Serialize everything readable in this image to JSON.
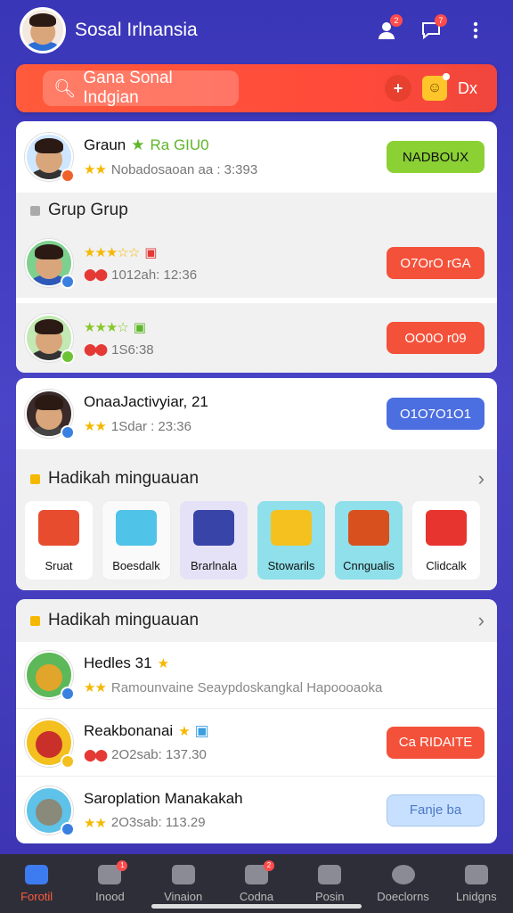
{
  "header": {
    "title": "Sosal Irlnansia",
    "friends_badge": "2",
    "chat_badge": "7"
  },
  "search": {
    "placeholder": "Gana Sonal Indgian",
    "right_label": "Dx"
  },
  "card1": {
    "row1": {
      "name": "Graun",
      "name_tag": "Ra GIU0",
      "meta": "Nobadosaoan aa : 3:393",
      "button": "NADBOUX"
    },
    "section_title": "Grup Grup",
    "row2": {
      "meta": "1012ah: 12:36",
      "button": "O7OrO rGA"
    },
    "row3": {
      "meta": "1S6:38",
      "button": "OO0O r09"
    }
  },
  "card2": {
    "row1": {
      "name": "OnaaJactivyiar, 21",
      "meta": "1Sdar : 23:36",
      "button": "O1O7O1O1"
    },
    "section_title": "Hadikah minguauan",
    "gifts": [
      {
        "label": "Sruat"
      },
      {
        "label": "Boesdalk"
      },
      {
        "label": "Brarlnala"
      },
      {
        "label": "Stowarils"
      },
      {
        "label": "Cnngualis"
      },
      {
        "label": "Clidcalk"
      }
    ]
  },
  "card3": {
    "section_title": "Hadikah minguauan",
    "row1": {
      "name": "Hedles 31",
      "meta": "Ramounvaine Seaypdoskangkal Hapoooaoka"
    },
    "row2": {
      "name": "Reakbonanai",
      "meta": "2O2sab: 137.30",
      "button": "Ca RIDAITE"
    },
    "row3": {
      "name": "Saroplation Manakakah",
      "meta": "2O3sab: 113.29",
      "button": "Fanje ba"
    }
  },
  "bottom_nav": [
    {
      "label": "Forotil",
      "badge": ""
    },
    {
      "label": "Inood",
      "badge": "1"
    },
    {
      "label": "Vinaion",
      "badge": ""
    },
    {
      "label": "Codna",
      "badge": "2"
    },
    {
      "label": "Posin",
      "badge": ""
    },
    {
      "label": "Doeclorns",
      "badge": ""
    },
    {
      "label": "Lnidgns",
      "badge": ""
    }
  ],
  "colors": {
    "accent_red": "#f4513a",
    "accent_blue": "#4b6ee0",
    "accent_green": "#8bd134",
    "bg_purple": "#3a36b8"
  }
}
